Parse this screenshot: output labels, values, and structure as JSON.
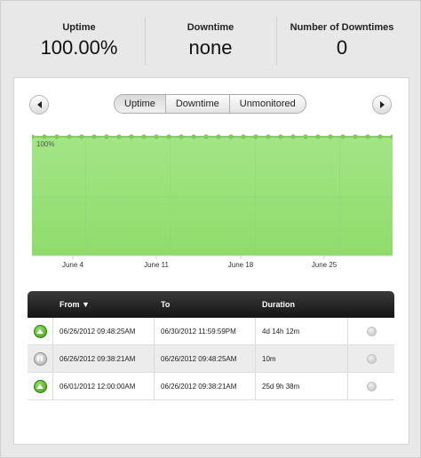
{
  "stats": [
    {
      "label": "Uptime",
      "value": "100.00%"
    },
    {
      "label": "Downtime",
      "value": "none"
    },
    {
      "label": "Number of Downtimes",
      "value": "0"
    }
  ],
  "tabs": [
    {
      "label": "Uptime",
      "active": true
    },
    {
      "label": "Downtime",
      "active": false
    },
    {
      "label": "Unmonitored",
      "active": false
    }
  ],
  "chart_data": {
    "type": "area",
    "series": [
      {
        "values": [
          100,
          100,
          100,
          100,
          100,
          100,
          100,
          100,
          100,
          100,
          100,
          100,
          100,
          100,
          100,
          100,
          100,
          100,
          100,
          100,
          100,
          100,
          100,
          100,
          100,
          100,
          100,
          100,
          100,
          100
        ]
      }
    ],
    "y_label_top": "100%",
    "x_tick_labels": [
      "June 4",
      "June 11",
      "June 18",
      "June 25"
    ],
    "colors": {
      "fill": "#a2e586",
      "fill_bottom": "#8fdc6b",
      "line": "#6fbf48",
      "point": "#7ecb54"
    },
    "ylim": [
      0,
      100
    ],
    "grid": true
  },
  "table": {
    "headers": [
      "From ▼",
      "To",
      "Duration"
    ],
    "rows": [
      {
        "status": "up",
        "from": "06/26/2012 09:48:25AM",
        "to": "06/30/2012 11:59:59PM",
        "duration": "4d 14h 12m"
      },
      {
        "status": "paused",
        "from": "06/26/2012 09:38:21AM",
        "to": "06/26/2012 09:48:25AM",
        "duration": "10m"
      },
      {
        "status": "up",
        "from": "06/01/2012 12:00:00AM",
        "to": "06/26/2012 09:38:21AM",
        "duration": "25d 9h 38m"
      }
    ]
  }
}
